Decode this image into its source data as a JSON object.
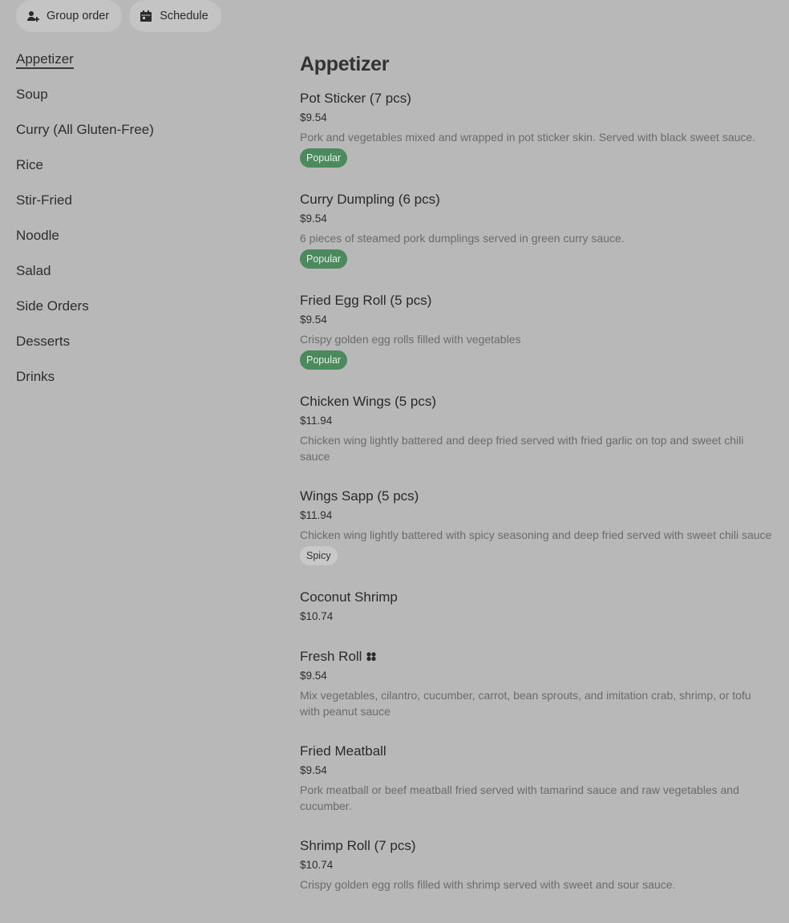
{
  "topbar": {
    "group_order": "Group order",
    "schedule": "Schedule"
  },
  "sidebar": {
    "items": [
      {
        "label": "Appetizer",
        "active": true
      },
      {
        "label": "Soup"
      },
      {
        "label": "Curry (All Gluten-Free)"
      },
      {
        "label": "Rice"
      },
      {
        "label": "Stir-Fried"
      },
      {
        "label": "Noodle"
      },
      {
        "label": "Salad"
      },
      {
        "label": "Side Orders"
      },
      {
        "label": "Desserts"
      },
      {
        "label": "Drinks"
      }
    ]
  },
  "main": {
    "section_title": "Appetizer",
    "items": [
      {
        "name": "Pot Sticker (7 pcs)",
        "price": "$9.54",
        "desc": "Pork and vegetables mixed and wrapped in pot sticker skin. Served with black sweet sauce.",
        "badge": "Popular"
      },
      {
        "name": "Curry Dumpling (6 pcs)",
        "price": "$9.54",
        "desc": "6 pieces of steamed pork dumplings served in green curry sauce.",
        "badge": "Popular"
      },
      {
        "name": "Fried Egg Roll (5 pcs)",
        "price": "$9.54",
        "desc": "Crispy golden egg rolls filled with vegetables",
        "badge": "Popular"
      },
      {
        "name": "Chicken Wings (5 pcs)",
        "price": "$11.94",
        "desc": "Chicken wing lightly battered and deep fried served with fried garlic on top and sweet chili sauce"
      },
      {
        "name": "Wings Sapp (5 pcs)",
        "price": "$11.94",
        "desc": "Chicken wing lightly battered with spicy seasoning and deep fried served with sweet chili sauce",
        "badge": "Spicy"
      },
      {
        "name": "Coconut Shrimp",
        "price": "$10.74"
      },
      {
        "name": "Fresh Roll",
        "price": "$9.54",
        "desc": "Mix vegetables, cilantro, cucumber, carrot, bean sprouts, and imitation crab, shrimp, or tofu with peanut sauce",
        "icon": "vegetarian-leaf-icon"
      },
      {
        "name": "Fried Meatball",
        "price": "$9.54",
        "desc": "Pork meatball or beef meatball fried served with tamarind sauce and raw vegetables and cucumber."
      },
      {
        "name": "Shrimp Roll (7 pcs)",
        "price": "$10.74",
        "desc": "Crispy golden egg rolls filled with shrimp served with sweet and sour sauce."
      }
    ]
  },
  "colors": {
    "background": "#b8b8b8",
    "popular_badge": "#4a8a5c",
    "spicy_badge": "#c8c8c8"
  }
}
